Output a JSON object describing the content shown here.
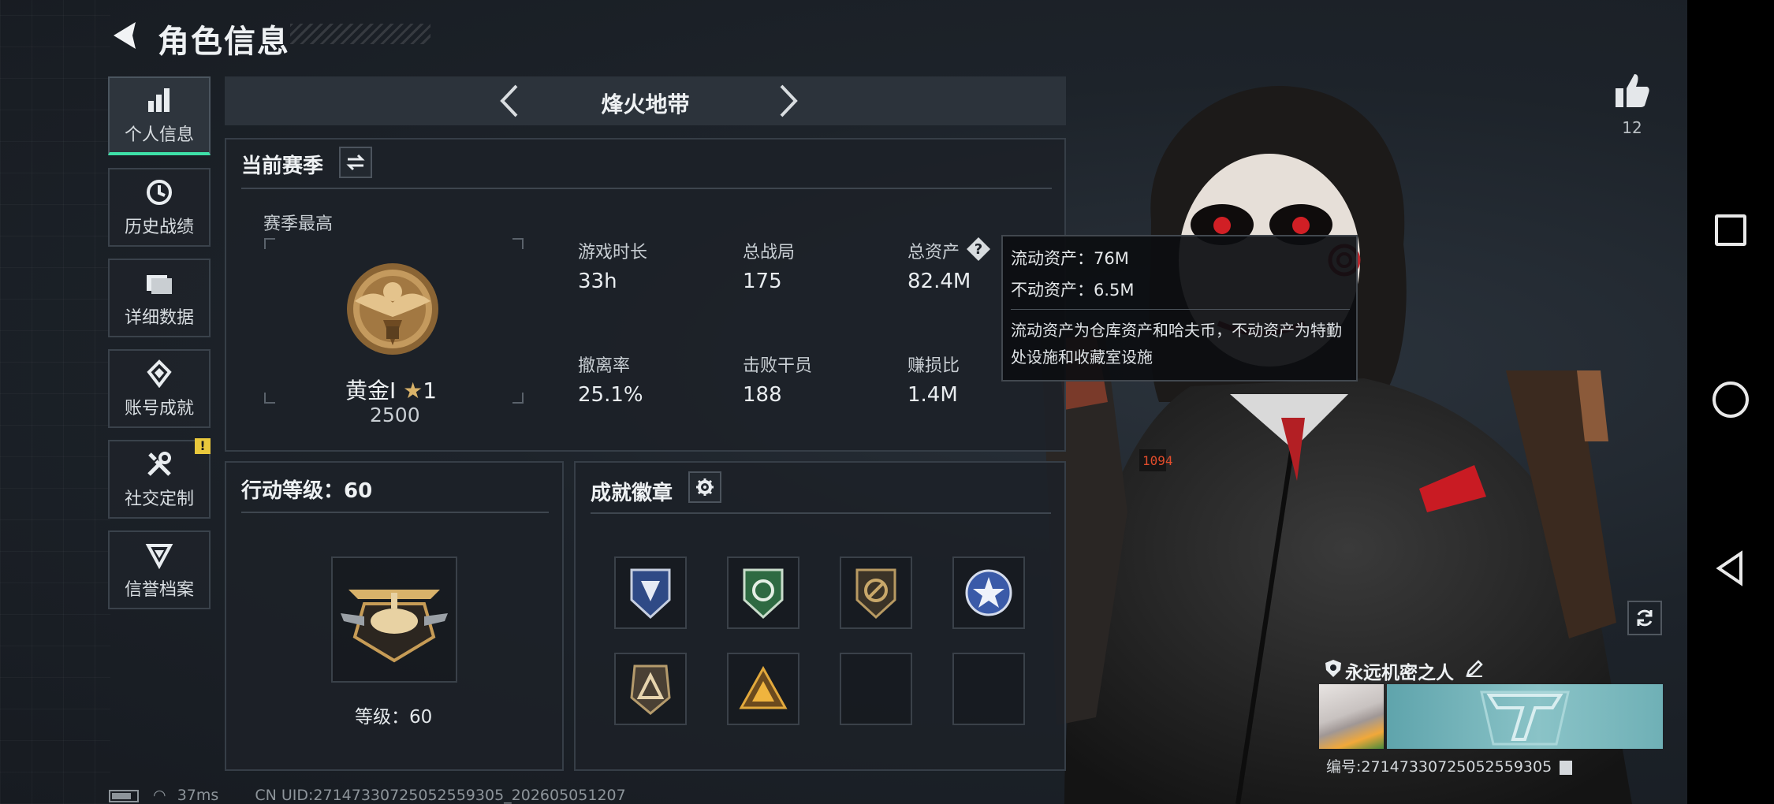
{
  "header": {
    "title": "角色信息"
  },
  "sidebar": {
    "items": [
      {
        "label": "个人信息",
        "icon": "bar-chart-icon",
        "active": true
      },
      {
        "label": "历史战绩",
        "icon": "history-icon"
      },
      {
        "label": "详细数据",
        "icon": "folder-icon"
      },
      {
        "label": "账号成就",
        "icon": "achievement-icon"
      },
      {
        "label": "社交定制",
        "icon": "tools-icon",
        "badge": "!"
      },
      {
        "label": "信誉档案",
        "icon": "credit-icon"
      }
    ]
  },
  "mode": {
    "title": "烽火地带"
  },
  "season": {
    "title": "当前赛季",
    "best_label": "赛季最高",
    "rank_name": "黄金Ⅰ",
    "rank_stars": "1",
    "rank_points": "2500",
    "stats": [
      {
        "label": "游戏时长",
        "value": "33h"
      },
      {
        "label": "总战局",
        "value": "175"
      },
      {
        "label": "总资产",
        "value": "82.4M"
      },
      {
        "label": "撤离率",
        "value": "25.1%"
      },
      {
        "label": "击败干员",
        "value": "188"
      },
      {
        "label": "赚损比",
        "value": "1.4M"
      }
    ]
  },
  "tooltip": {
    "liquid": "流动资产：76M",
    "fixed": "不动资产：6.5M",
    "desc": "流动资产为仓库资产和哈夫币，不动资产为特勤处设施和收藏室设施"
  },
  "action_level": {
    "title": "行动等级：60",
    "level_label": "等级：60"
  },
  "badges": {
    "title": "成就徽章"
  },
  "social": {
    "likes": "12"
  },
  "player": {
    "name": "永远机密之人",
    "uid_label": "编号:271473307250525593​05"
  },
  "status": {
    "ping": "37ms",
    "cn_uid": "CN UID:27147330725052559305_202605051207"
  },
  "colors": {
    "accent": "#3ee0a8",
    "badge_warn": "#e9c83c",
    "namecard": "#7ab8be"
  }
}
